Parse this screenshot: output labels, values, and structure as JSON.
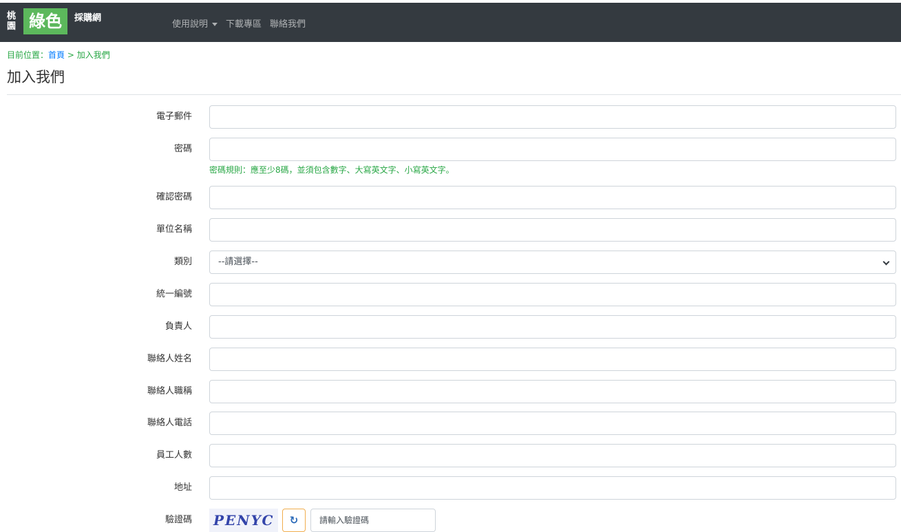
{
  "navbar": {
    "logo_city": "桃園",
    "logo_green": "綠色",
    "logo_sub": "採購網",
    "links": [
      "使用說明",
      "下載專區",
      "聯絡我們"
    ]
  },
  "breadcrumb": {
    "prefix": "目前位置：",
    "home": "首頁",
    "separator": " > ",
    "current": "加入我們"
  },
  "page": {
    "title": "加入我們"
  },
  "form": {
    "email_label": "電子郵件",
    "password_label": "密碼",
    "password_help": "密碼規則：應至少8碼，並須包含數字、大寫英文字、小寫英文字。",
    "confirm_label": "確認密碼",
    "unit_label": "單位名稱",
    "category_label": "類別",
    "category_value": "--請選擇--",
    "tax_id_label": "統一編號",
    "owner_label": "負責人",
    "contact_name_label": "聯絡人姓名",
    "contact_title_label": "聯絡人職稱",
    "contact_phone_label": "聯絡人電話",
    "employees_label": "員工人數",
    "address_label": "地址",
    "captcha_label": "驗證碼",
    "captcha_text": "PENYC",
    "captcha_placeholder": "請輸入驗證碼"
  },
  "colors": {
    "navbar_bg": "#343a40",
    "logo_green": "#5cb85c",
    "help_green": "#28a745",
    "link_blue": "#007bff"
  }
}
